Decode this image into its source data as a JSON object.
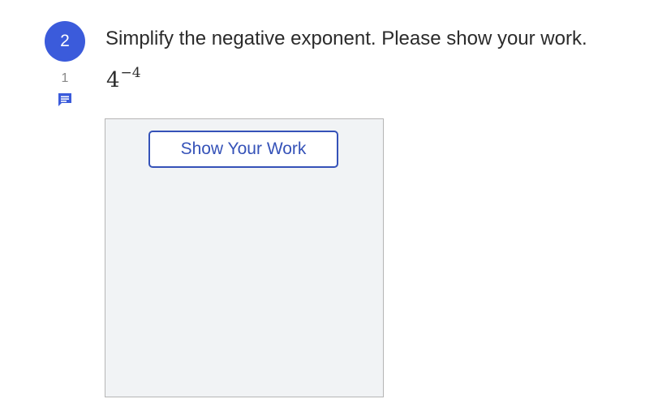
{
  "question": {
    "number": "2",
    "comment_count": "1",
    "comment_icon": "comment-icon",
    "prompt": "Simplify the negative exponent. Please show your work.",
    "expression": {
      "base": "4",
      "exponent": "−4"
    }
  },
  "work_area": {
    "button_label": "Show Your Work"
  },
  "colors": {
    "accent": "#3b5bdb",
    "button_border": "#3552b8",
    "work_area_bg": "#f1f3f5"
  }
}
